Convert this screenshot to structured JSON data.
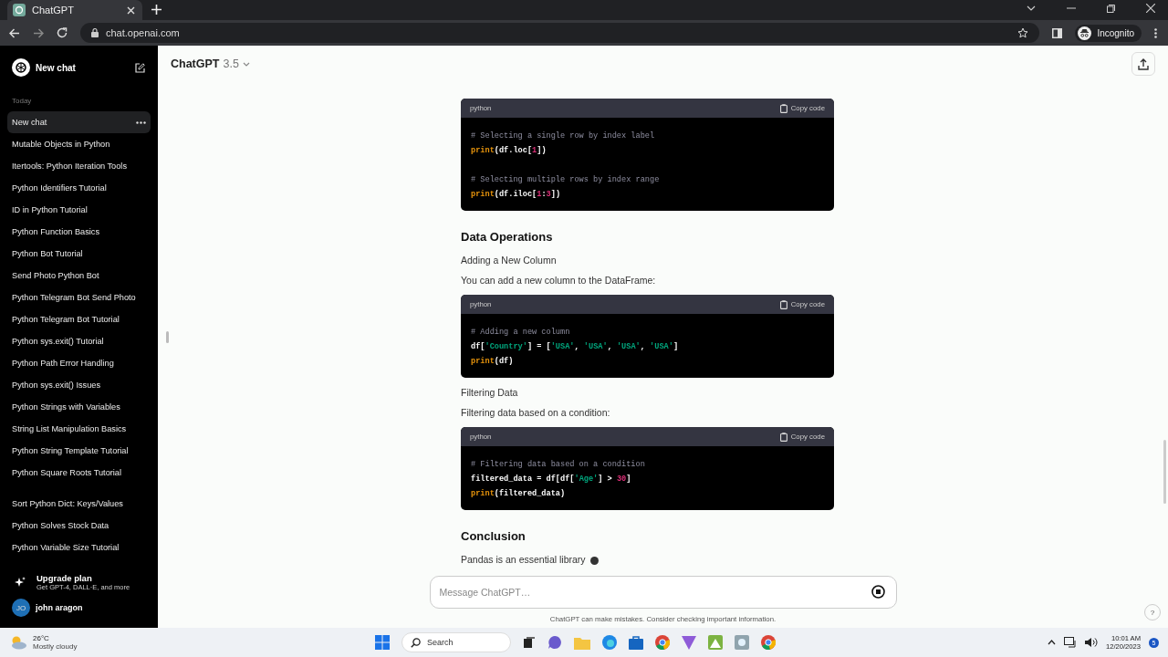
{
  "browser": {
    "tab": {
      "title": "ChatGPT",
      "selected": true
    },
    "url": "chat.openai.com",
    "profile": "Incognito"
  },
  "sidebar": {
    "new_chat": "New chat",
    "groups": [
      {
        "label": "Today",
        "items": [
          {
            "title": "New chat",
            "selected": true
          },
          {
            "title": "Mutable Objects in Python",
            "selected": false
          },
          {
            "title": "Itertools: Python Iteration Tools",
            "selected": false
          },
          {
            "title": "Python Identifiers Tutorial",
            "selected": false
          },
          {
            "title": "ID in Python Tutorial",
            "selected": false
          },
          {
            "title": "Python Function Basics",
            "selected": false
          },
          {
            "title": "Python Bot Tutorial",
            "selected": false
          },
          {
            "title": "Send Photo Python Bot",
            "selected": false
          },
          {
            "title": "Python Telegram Bot Send Photo",
            "selected": false
          },
          {
            "title": "Python Telegram Bot Tutorial",
            "selected": false
          },
          {
            "title": "Python sys.exit() Tutorial",
            "selected": false
          },
          {
            "title": "Python Path Error Handling",
            "selected": false
          },
          {
            "title": "Python sys.exit() Issues",
            "selected": false
          },
          {
            "title": "Python Strings with Variables",
            "selected": false
          },
          {
            "title": "String List Manipulation Basics",
            "selected": false
          },
          {
            "title": "Python String Template Tutorial",
            "selected": false
          },
          {
            "title": "Python Square Roots Tutorial",
            "selected": false
          }
        ]
      },
      {
        "items": [
          {
            "title": "Sort Python Dict: Keys/Values",
            "selected": false
          },
          {
            "title": "Python Solves Stock Data",
            "selected": false
          },
          {
            "title": "Python Variable Size Tutorial",
            "selected": false
          }
        ]
      }
    ],
    "upgrade": {
      "title": "Upgrade plan",
      "subtitle": "Get GPT-4, DALL·E, and more"
    },
    "user": {
      "initials": "JO",
      "name": "john aragon"
    }
  },
  "header": {
    "title": "ChatGPT",
    "version": "3.5"
  },
  "content": [
    {
      "kind": "code",
      "language": "python",
      "copy": "Copy code",
      "lines": [
        {
          "kind": "code",
          "tokens": [
            {
              "kind": "comment",
              "text": "# Selecting a single row by index label"
            }
          ]
        },
        {
          "kind": "code",
          "tokens": [
            {
              "kind": "builtin",
              "text": "print"
            },
            {
              "kind": "plain",
              "text": "(df.loc["
            },
            {
              "kind": "number",
              "text": "1"
            },
            {
              "kind": "plain",
              "text": "])"
            }
          ]
        },
        {
          "kind": "blank"
        },
        {
          "kind": "code",
          "tokens": [
            {
              "kind": "comment",
              "text": "# Selecting multiple rows by index range"
            }
          ]
        },
        {
          "kind": "code",
          "tokens": [
            {
              "kind": "builtin",
              "text": "print"
            },
            {
              "kind": "plain",
              "text": "(df.iloc["
            },
            {
              "kind": "number",
              "text": "1"
            },
            {
              "kind": "plain",
              "text": ":"
            },
            {
              "kind": "number",
              "text": "3"
            },
            {
              "kind": "plain",
              "text": "])"
            }
          ]
        }
      ]
    },
    {
      "kind": "heading",
      "text": "Data Operations"
    },
    {
      "kind": "paragraph",
      "text": "Adding a New Column"
    },
    {
      "kind": "paragraph",
      "text": "You can add a new column to the DataFrame:"
    },
    {
      "kind": "code",
      "language": "python",
      "copy": "Copy code",
      "lines": [
        {
          "kind": "code",
          "tokens": [
            {
              "kind": "comment",
              "text": "# Adding a new column"
            }
          ]
        },
        {
          "kind": "code",
          "tokens": [
            {
              "kind": "plain",
              "text": "df["
            },
            {
              "kind": "string",
              "text": "'Country'"
            },
            {
              "kind": "plain",
              "text": "] = ["
            },
            {
              "kind": "string",
              "text": "'USA'"
            },
            {
              "kind": "plain",
              "text": ", "
            },
            {
              "kind": "string",
              "text": "'USA'"
            },
            {
              "kind": "plain",
              "text": ", "
            },
            {
              "kind": "string",
              "text": "'USA'"
            },
            {
              "kind": "plain",
              "text": ", "
            },
            {
              "kind": "string",
              "text": "'USA'"
            },
            {
              "kind": "plain",
              "text": "]"
            }
          ]
        },
        {
          "kind": "code",
          "tokens": [
            {
              "kind": "builtin",
              "text": "print"
            },
            {
              "kind": "plain",
              "text": "(df)"
            }
          ]
        }
      ]
    },
    {
      "kind": "paragraph",
      "text": "Filtering Data"
    },
    {
      "kind": "paragraph",
      "text": "Filtering data based on a condition:"
    },
    {
      "kind": "code",
      "language": "python",
      "copy": "Copy code",
      "lines": [
        {
          "kind": "code",
          "tokens": [
            {
              "kind": "comment",
              "text": "# Filtering data based on a condition"
            }
          ]
        },
        {
          "kind": "code",
          "tokens": [
            {
              "kind": "plain",
              "text": "filtered_data = df[df["
            },
            {
              "kind": "string",
              "text": "'Age'"
            },
            {
              "kind": "plain",
              "text": "] > "
            },
            {
              "kind": "number",
              "text": "30"
            },
            {
              "kind": "plain",
              "text": "]"
            }
          ]
        },
        {
          "kind": "code",
          "tokens": [
            {
              "kind": "builtin",
              "text": "print"
            },
            {
              "kind": "plain",
              "text": "(filtered_data)"
            }
          ]
        }
      ]
    },
    {
      "kind": "heading",
      "text": "Conclusion"
    },
    {
      "kind": "paragraph",
      "text": "Pandas is an essential library",
      "streaming": true
    }
  ],
  "composer": {
    "placeholder": "Message ChatGPT…"
  },
  "disclaimer": "ChatGPT can make mistakes. Consider checking important information.",
  "help": "?",
  "taskbar": {
    "weather": {
      "temp": "26°C",
      "condition": "Mostly cloudy"
    },
    "search": "Search",
    "time": "10:01 AM",
    "date": "12/20/2023",
    "badge": "5"
  }
}
